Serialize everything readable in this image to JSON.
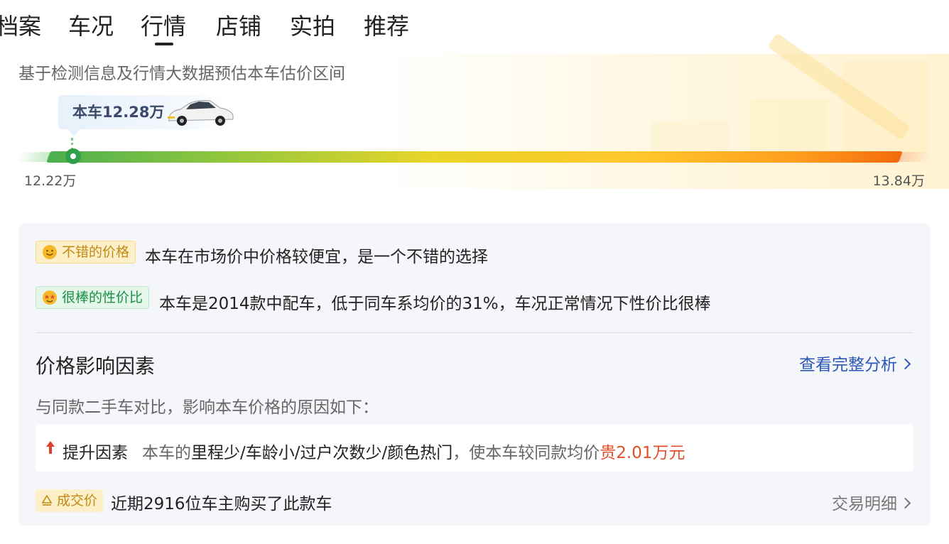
{
  "tabs": [
    {
      "label": "档案"
    },
    {
      "label": "车况"
    },
    {
      "label": "行情"
    },
    {
      "label": "店铺"
    },
    {
      "label": "实拍"
    },
    {
      "label": "推荐"
    }
  ],
  "active_tab": "行情",
  "valuation": {
    "subtitle": "基于检测信息及行情大数据预估本车估价区间",
    "current_price_label": "本车12.28万",
    "min_price": "12.22万",
    "max_price": "13.84万",
    "current_price_value": 12.28,
    "range": [
      12.22,
      13.84
    ]
  },
  "highlights": [
    {
      "tag": "不错的价格",
      "text": "本车在市场价中价格较便宜，是一个不错的选择",
      "icon": "smile-emoji-icon"
    },
    {
      "tag": "很棒的性价比",
      "text": "本车是2014款中配车，低于同车系均价的31%，车况正常情况下性价比很棒",
      "icon": "star-eyes-emoji-icon"
    }
  ],
  "factors": {
    "title": "价格影响因素",
    "link": "查看完整分析",
    "note": "与同款二手车对比，影响本车价格的原因如下：",
    "up_label": "提升因素",
    "up_prefix": "本车的",
    "up_items": "里程少/车龄小/过户次数少/颜色热门",
    "up_middle": "，使本车较同款均价",
    "up_result": "贵2.01万元"
  },
  "deal": {
    "tag": "成交价",
    "text": "近期2916位车主购买了此款车",
    "link": "交易明细"
  },
  "colors": {
    "bar_start": "#4caf50",
    "bar_end": "#f36b0c",
    "link_blue": "#2a57b8",
    "highlight_red": "#e0502a"
  }
}
